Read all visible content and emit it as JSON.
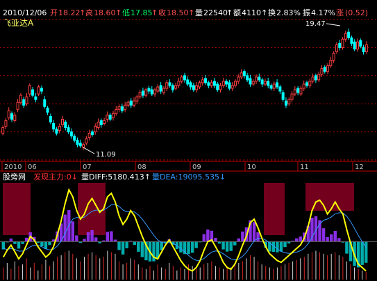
{
  "chart_data": [
    {
      "type": "candlestick",
      "title": "飞亚达A",
      "info": {
        "date": "2010/12/06",
        "open_label": "开",
        "open": "18.22",
        "open_arrow": "↑",
        "high_label": "高",
        "high": "18.60",
        "high_arrow": "↑",
        "low_label": "低",
        "low": "17.85",
        "low_arrow": "↑",
        "close_label": "收",
        "close": "18.50",
        "close_arrow": "↑",
        "volume_label": "量",
        "volume": "22540",
        "volume_arrow": "↑",
        "amount_label": "额",
        "amount": "4110",
        "amount_arrow": "↑",
        "turnover_label": "换",
        "turnover": "2.83%",
        "amplitude_label": "振",
        "amplitude": "4.17%",
        "change_label": "涨",
        "change": "(0.52)"
      },
      "markers": {
        "high_mark": "19.47",
        "low_mark": "11.09"
      },
      "x_ticks": [
        "2010",
        "06",
        "07",
        "08",
        "09",
        "10",
        "11",
        "12"
      ],
      "ylim": [
        10.3,
        20.3
      ],
      "grid": true,
      "colors": {
        "up": "#ff4040",
        "down": "#00ffff",
        "grid": "#b00000",
        "axis": "#c00000"
      },
      "close_series": [
        12.6,
        13.1,
        13.8,
        13.2,
        13.5,
        14.4,
        14.9,
        14.2,
        14.8,
        15.6,
        14.9,
        14.6,
        15.5,
        15.2,
        14.1,
        13.7,
        13.0,
        12.5,
        12.2,
        12.7,
        13.2,
        12.6,
        12.3,
        12.0,
        11.7,
        11.4,
        11.3,
        11.4,
        11.8,
        12.2,
        12.1,
        12.7,
        13.0,
        12.8,
        13.1,
        13.5,
        13.2,
        13.6,
        13.9,
        14.1,
        13.8,
        14.2,
        14.4,
        14.2,
        14.5,
        14.8,
        15.1,
        14.9,
        15.3,
        15.2,
        15.0,
        15.3,
        15.5,
        15.2,
        15.4,
        15.8,
        15.6,
        15.3,
        15.6,
        15.9,
        16.2,
        16.0,
        15.7,
        15.5,
        15.3,
        15.6,
        15.8,
        16.0,
        15.8,
        15.6,
        15.8,
        15.6,
        15.3,
        15.6,
        15.9,
        15.7,
        15.4,
        15.6,
        15.9,
        16.2,
        16.5,
        16.3,
        16.0,
        15.7,
        15.9,
        16.2,
        16.0,
        15.7,
        15.9,
        15.6,
        15.4,
        15.7,
        15.5,
        15.2,
        14.6,
        14.2,
        14.6,
        15.0,
        15.3,
        15.1,
        15.4,
        15.7,
        15.6,
        15.9,
        16.2,
        16.0,
        16.4,
        16.8,
        16.6,
        17.0,
        17.4,
        17.9,
        18.5,
        18.3,
        18.9,
        19.3,
        19.0,
        18.6,
        18.2,
        18.7,
        18.4,
        18.0,
        18.5
      ],
      "open_series": [
        12.2,
        12.7,
        13.3,
        13.6,
        13.1,
        13.9,
        14.4,
        14.6,
        14.3,
        15.0,
        15.3,
        14.8,
        15.0,
        15.4,
        14.6,
        14.0,
        13.4,
        12.9,
        12.5,
        12.4,
        12.8,
        13.0,
        12.6,
        12.3,
        12.0,
        11.7,
        11.5,
        11.2,
        11.5,
        11.9,
        12.3,
        12.3,
        12.6,
        13.1,
        12.9,
        13.2,
        13.5,
        13.3,
        13.6,
        13.9,
        14.1,
        13.9,
        14.2,
        14.5,
        14.2,
        14.5,
        14.8,
        15.2,
        14.9,
        15.4,
        15.3,
        15.0,
        15.2,
        15.6,
        15.1,
        15.4,
        15.8,
        15.6,
        15.4,
        15.6,
        15.9,
        16.3,
        16.0,
        15.8,
        15.6,
        15.3,
        15.5,
        15.8,
        16.1,
        15.8,
        15.6,
        15.9,
        15.7,
        15.3,
        15.6,
        15.9,
        15.8,
        15.4,
        15.6,
        15.9,
        16.2,
        16.6,
        16.3,
        16.1,
        15.7,
        15.9,
        16.2,
        16.0,
        15.7,
        15.9,
        15.6,
        15.4,
        15.8,
        15.5,
        15.1,
        14.5,
        14.3,
        14.6,
        15.0,
        15.4,
        15.0,
        15.4,
        15.8,
        15.6,
        15.9,
        16.3,
        16.0,
        16.4,
        16.9,
        16.6,
        17.0,
        17.4,
        18.0,
        18.6,
        18.3,
        18.9,
        19.4,
        19.0,
        18.7,
        18.2,
        18.8,
        18.3,
        18.0
      ]
    },
    {
      "type": "line",
      "indicator_name": "股旁网",
      "subtitle": "发现主力:0↓",
      "diff_label": "量DIFF:5180.413↑",
      "dea_label": "量DEA:19095.535↓",
      "series": [
        {
          "name": "量DIFF",
          "color": "#ffff00",
          "values": [
            -0.9,
            -0.5,
            -0.2,
            -0.6,
            -1.0,
            -0.7,
            -0.2,
            0.3,
            0.1,
            -0.3,
            -0.6,
            -0.9,
            -0.7,
            -0.3,
            0.4,
            1.2,
            2.2,
            3.0,
            2.6,
            1.8,
            1.3,
            1.6,
            2.2,
            2.5,
            2.1,
            1.7,
            1.9,
            2.6,
            2.8,
            2.3,
            1.5,
            1.0,
            1.3,
            1.8,
            1.5,
            0.9,
            0.3,
            -0.2,
            -0.6,
            -0.9,
            -1.0,
            -0.6,
            -0.2,
            0.1,
            -0.3,
            -0.7,
            -1.1,
            -1.4,
            -1.6,
            -1.7,
            -1.5,
            -1.1,
            -0.5,
            0.0,
            0.1,
            -0.3,
            -0.7,
            -1.2,
            -1.5,
            -1.6,
            -1.3,
            -0.8,
            -0.2,
            0.3,
            1.1,
            1.3,
            0.8,
            0.2,
            -0.3,
            -0.7,
            -0.9,
            -1.1,
            -1.2,
            -1.0,
            -0.8,
            -0.6,
            -0.4,
            -0.2,
            0.2,
            0.9,
            1.8,
            2.3,
            2.4,
            2.1,
            1.6,
            1.9,
            2.3,
            1.9,
            1.6,
            0.7,
            -0.1,
            -0.8,
            -1.3,
            -1.5,
            -1.7
          ]
        },
        {
          "name": "量DEA",
          "color": "#3399ff",
          "values": [
            -0.4,
            -0.45,
            -0.4,
            -0.45,
            -0.55,
            -0.55,
            -0.45,
            -0.3,
            -0.2,
            -0.22,
            -0.3,
            -0.42,
            -0.48,
            -0.44,
            -0.26,
            0.03,
            0.46,
            0.97,
            1.3,
            1.4,
            1.38,
            1.42,
            1.59,
            1.76,
            1.83,
            1.81,
            1.82,
            1.97,
            2.13,
            2.17,
            2.04,
            1.83,
            1.73,
            1.75,
            1.71,
            1.55,
            1.3,
            1.0,
            0.68,
            0.37,
            0.1,
            -0.04,
            -0.08,
            -0.05,
            -0.1,
            -0.22,
            -0.4,
            -0.6,
            -0.8,
            -0.98,
            -1.08,
            -1.09,
            -0.98,
            -0.78,
            -0.6,
            -0.54,
            -0.57,
            -0.7,
            -0.86,
            -1.0,
            -1.06,
            -1.01,
            -0.85,
            -0.62,
            -0.28,
            0.04,
            0.19,
            0.19,
            0.09,
            -0.07,
            -0.24,
            -0.41,
            -0.57,
            -0.65,
            -0.68,
            -0.66,
            -0.61,
            -0.53,
            -0.38,
            -0.12,
            0.26,
            0.67,
            1.02,
            1.24,
            1.31,
            1.43,
            1.61,
            1.67,
            1.66,
            1.47,
            1.16,
            0.77,
            0.36,
            0.0,
            -0.34
          ]
        }
      ],
      "colors": {
        "bar_up": "#ff3030",
        "bar_down": "#00c0c0",
        "band": "#800020",
        "bar_purple": "#9933ff"
      },
      "bar_values": [
        0.4,
        0.55,
        0.35,
        0.6,
        0.45,
        0.5,
        0.7,
        0.4,
        0.55,
        0.3,
        0.5,
        0.65,
        0.45,
        0.6,
        0.75,
        0.8,
        0.9,
        0.95,
        0.85,
        0.7,
        0.6,
        0.75,
        0.85,
        0.9,
        0.8,
        0.7,
        0.75,
        0.95,
        0.9,
        0.85,
        0.6,
        0.5,
        0.55,
        0.7,
        0.65,
        0.5,
        0.4,
        0.35,
        0.45,
        0.3,
        0.5,
        0.4,
        0.35,
        0.55,
        0.45,
        0.3,
        0.4,
        0.35,
        0.5,
        0.45,
        0.35,
        0.4,
        0.5,
        0.55,
        0.6,
        0.45,
        0.4,
        0.35,
        0.45,
        0.4,
        0.5,
        0.55,
        0.6,
        0.7,
        0.8,
        0.75,
        0.6,
        0.5,
        0.45,
        0.4,
        0.35,
        0.4,
        0.45,
        0.5,
        0.55,
        0.6,
        0.65,
        0.7,
        0.75,
        0.85,
        0.9,
        0.95,
        0.9,
        0.85,
        0.8,
        0.85,
        0.9,
        0.8,
        0.75,
        0.6,
        0.5,
        0.4,
        0.35,
        0.3,
        0.25
      ],
      "ylim": [
        -2.2,
        3.4
      ]
    }
  ]
}
